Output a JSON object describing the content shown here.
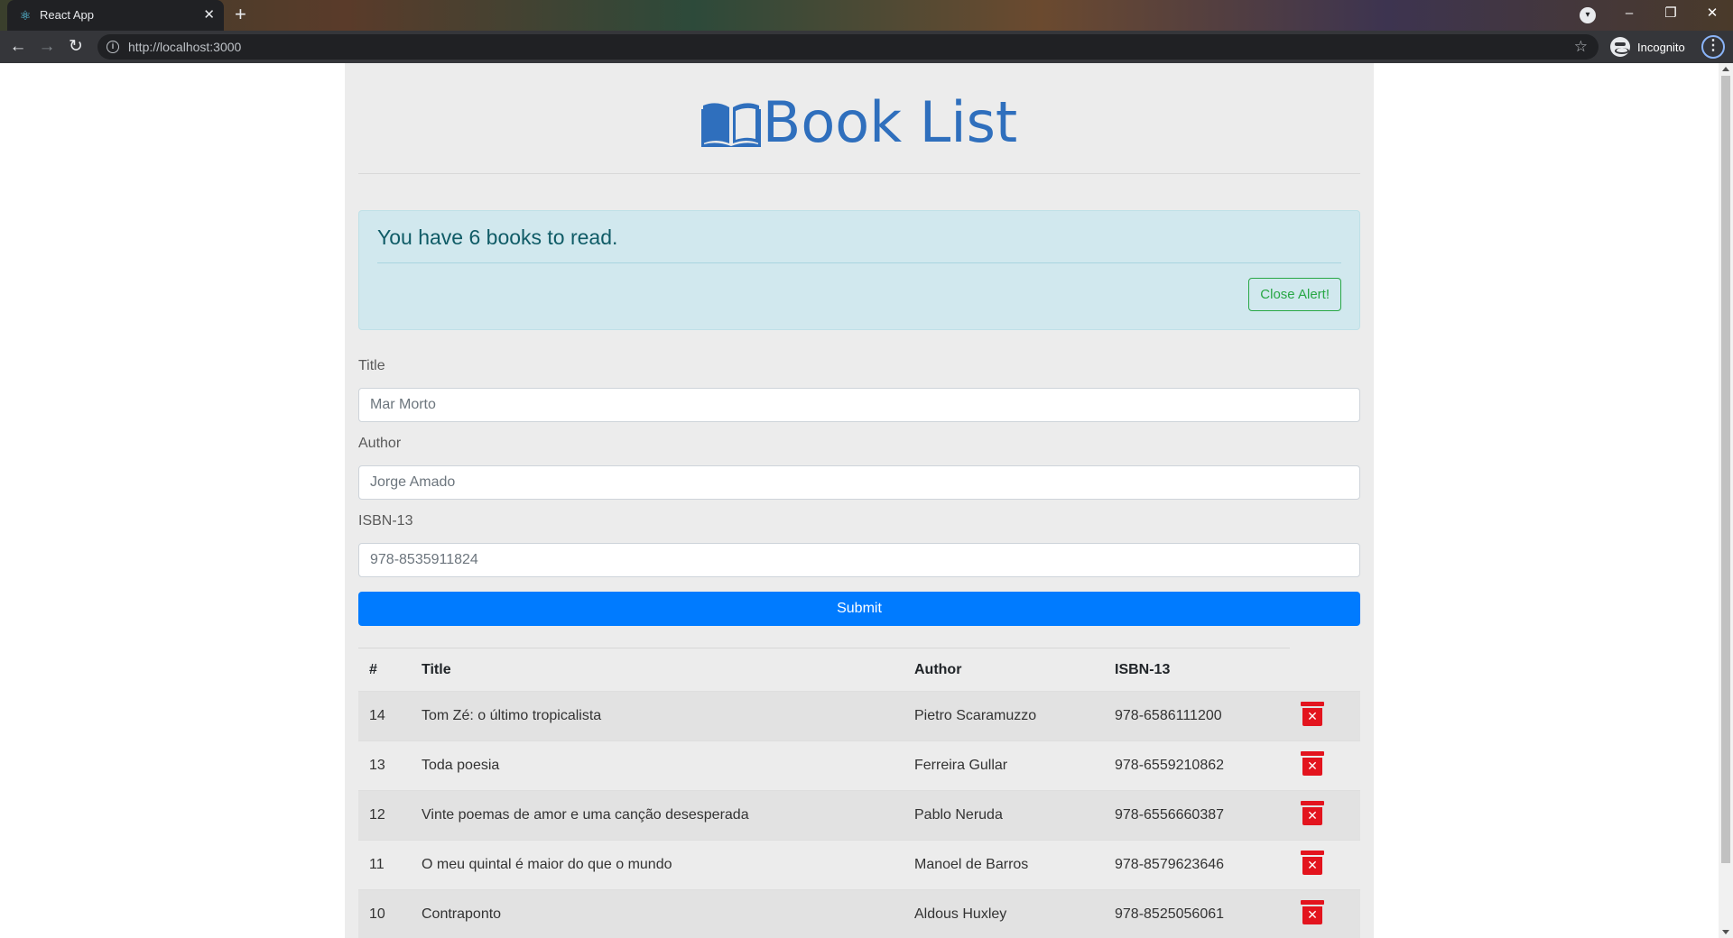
{
  "browser": {
    "tab_title": "React App",
    "tab_close": "✕",
    "new_tab": "+",
    "url": "http://localhost:3000",
    "incognito_label": "Incognito",
    "window_controls": {
      "minimize": "–",
      "restore": "❐",
      "close": "✕"
    }
  },
  "header": {
    "title": "Book List",
    "icon": "open-book-icon",
    "title_color": "#2f6fbd"
  },
  "alert": {
    "heading": "You have 6 books to read.",
    "close_label": "Close Alert!"
  },
  "form": {
    "title_label": "Title",
    "title_placeholder": "Mar Morto",
    "author_label": "Author",
    "author_placeholder": "Jorge Amado",
    "isbn_label": "ISBN-13",
    "isbn_placeholder": "978-8535911824",
    "submit_label": "Submit",
    "submit_color": "#007bff"
  },
  "table": {
    "headers": {
      "num": "#",
      "title": "Title",
      "author": "Author",
      "isbn": "ISBN-13"
    },
    "delete_icon": "trash-delete-icon",
    "rows": [
      {
        "num": "14",
        "title": "Tom Zé: o último tropicalista",
        "author": "Pietro Scaramuzzo",
        "isbn": "978-6586111200"
      },
      {
        "num": "13",
        "title": "Toda poesia",
        "author": "Ferreira Gullar",
        "isbn": "978-6559210862"
      },
      {
        "num": "12",
        "title": "Vinte poemas de amor e uma canção desesperada",
        "author": "Pablo Neruda",
        "isbn": "978-6556660387"
      },
      {
        "num": "11",
        "title": "O meu quintal é maior do que o mundo",
        "author": "Manoel de Barros",
        "isbn": "978-8579623646"
      },
      {
        "num": "10",
        "title": "Contraponto",
        "author": "Aldous Huxley",
        "isbn": "978-8525056061"
      }
    ]
  }
}
